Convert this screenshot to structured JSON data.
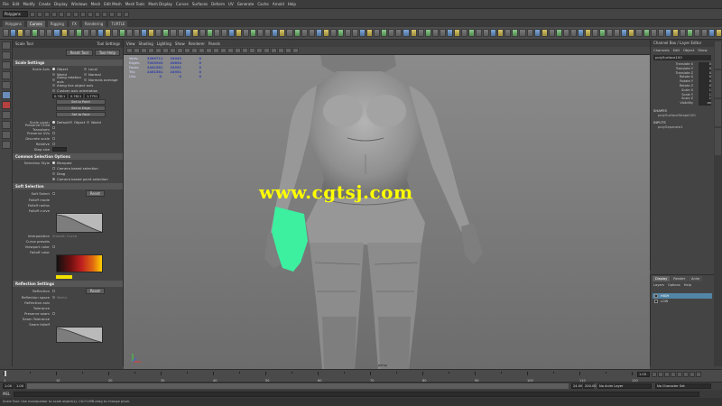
{
  "menubar": [
    "File",
    "Edit",
    "Modify",
    "Create",
    "Display",
    "Windows",
    "Mesh",
    "Edit Mesh",
    "Mesh Tools",
    "Mesh Display",
    "Curves",
    "Surfaces",
    "Deform",
    "UV",
    "Generate",
    "Cache",
    "Arnold",
    "Help"
  ],
  "status": {
    "mode": "Polygons"
  },
  "shelf_tabs": [
    {
      "label": "Polygons",
      "active": false
    },
    {
      "label": "Curves",
      "active": true
    },
    {
      "label": "Rigging",
      "active": false
    },
    {
      "label": "FX",
      "active": false
    },
    {
      "label": "Rendering",
      "active": false
    },
    {
      "label": "TURTLE",
      "active": false
    }
  ],
  "tool_settings": {
    "title": "Scale Tool",
    "header_right": "Tool Settings",
    "reset_label": "Reset Tool",
    "help_label": "Tool Help",
    "scale_settings": {
      "header": "Scale Settings",
      "axis_label": "Scale Axis",
      "axis_options": [
        "Object",
        "Local",
        "World",
        "Normal",
        "Along rotation axis",
        "Normals average",
        "Along live object axis",
        "Custom axis orientation"
      ],
      "xyz": [
        "0.7811",
        "0.7811",
        "1.7751"
      ],
      "set_buttons": [
        "Set to Point",
        "Set to Edge",
        "Set to Face"
      ],
      "pivot_label": "Scale pivot:",
      "pivot_options": [
        "Default",
        "Object",
        "World"
      ],
      "rows": [
        "Preserve Child Transform",
        "Preserve UVs",
        "Discrete scale",
        "Relative",
        "Step size"
      ]
    },
    "common_selection": {
      "header": "Common Selection Options",
      "style_label": "Selection Style",
      "style_option": "Marquee",
      "camera_based": "Camera based selection",
      "drag": "Drag",
      "camera_paint": "Camera based paint selection"
    },
    "soft_selection": {
      "header": "Soft Selection",
      "soft_select": "Soft Select",
      "reset": "Reset",
      "falloff_mode": "Falloff mode",
      "falloff_radius": "Falloff radius",
      "falloff_curve": "Falloff curve",
      "interpolation": "Interpolation",
      "interp_value": "Smooth Curve",
      "curve_presets": "Curve presets",
      "viewport_color": "Viewport color",
      "color_label": "Falloff color"
    },
    "reflection": {
      "header": "Reflection Settings",
      "reflection": "Reflection",
      "reset": "Reset",
      "reflection_space": "Reflection space",
      "space_value": "World",
      "reflection_axis": "Reflection axis",
      "tolerance": "Tolerance",
      "preserve": "Preserve seam",
      "seam_tolerance": "Seam Tolerance",
      "seam_falloff": "Seam falloff"
    }
  },
  "viewport": {
    "menus": [
      "View",
      "Shading",
      "Lighting",
      "Show",
      "Renderer",
      "Panels"
    ],
    "hud": [
      {
        "label": "Verts:",
        "a": "3389711",
        "b": "24943",
        "c": "0"
      },
      {
        "label": "Edges:",
        "a": "7003943",
        "b": "49894",
        "c": "0"
      },
      {
        "label": "Faces:",
        "a": "2461581",
        "b": "24951",
        "c": "0"
      },
      {
        "label": "Tris:",
        "a": "2461581",
        "b": "24951",
        "c": "0"
      },
      {
        "label": "UVs:",
        "a": "0",
        "b": "0",
        "c": "0"
      }
    ],
    "camera_label": "persp",
    "watermark": "www.cgtsj.com"
  },
  "channel_box": {
    "title": "Channel Box / Layer Editor",
    "menus": [
      "Channels",
      "Edit",
      "Object",
      "Show"
    ],
    "object_name": "polySurface100",
    "attributes": [
      {
        "name": "Translate X",
        "value": "0"
      },
      {
        "name": "Translate Y",
        "value": "0"
      },
      {
        "name": "Translate Z",
        "value": "0"
      },
      {
        "name": "Rotate X",
        "value": "0"
      },
      {
        "name": "Rotate Y",
        "value": "0"
      },
      {
        "name": "Rotate Z",
        "value": "0"
      },
      {
        "name": "Scale X",
        "value": "1"
      },
      {
        "name": "Scale Y",
        "value": "1"
      },
      {
        "name": "Scale Z",
        "value": "1"
      },
      {
        "name": "Visibility",
        "value": "on"
      }
    ],
    "shapes_label": "SHAPES",
    "shape_name": "polySurfaceShape100",
    "inputs_label": "INPUTS",
    "input_name": "polySeparate1"
  },
  "layer_editor": {
    "tabs": [
      {
        "label": "Display",
        "active": true
      },
      {
        "label": "Render",
        "active": false
      },
      {
        "label": "Anim",
        "active": false
      }
    ],
    "menus": [
      "Layers",
      "Options",
      "Help"
    ],
    "layers": [
      {
        "name": "HIGH",
        "selected": true
      },
      {
        "name": "LOW",
        "selected": false
      }
    ]
  },
  "timeline": {
    "start_label": "1",
    "end_label": "120",
    "current_frame": "1.00",
    "ticks": [
      "1",
      "10",
      "20",
      "30",
      "40",
      "50",
      "60",
      "70",
      "80",
      "90",
      "100",
      "110",
      "120"
    ]
  },
  "range": {
    "start": "1.00",
    "start2": "1.00",
    "end": "120",
    "end2": "24.00",
    "max": "200.00",
    "layer_label": "No Anim Layer",
    "char_label": "No Character Set"
  },
  "cmdline": {
    "label": "MEL"
  },
  "helpline": {
    "text": "Scale Tool: Use manipulator to scale object(s). Ctrl+LMB-drag to change pivot."
  },
  "colors": {
    "accent": "#5285a6",
    "watermark": "#ffff00",
    "soft_select": "#3cf0a0"
  }
}
